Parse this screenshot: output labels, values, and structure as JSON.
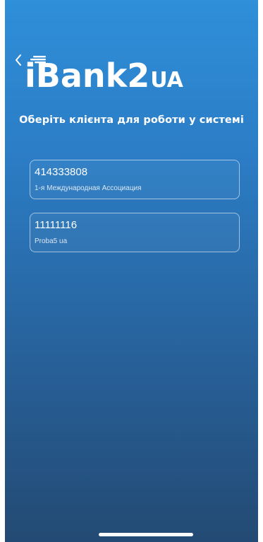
{
  "header": {
    "logo_main": "iBank2",
    "logo_suffix": "UA"
  },
  "heading": "Оберіть клієнта для роботи у системі",
  "clients": [
    {
      "id": "414333808",
      "name": "1-я Международная Ассоциация"
    },
    {
      "id": "11111116",
      "name": "Proba5 ua"
    }
  ],
  "colors": {
    "gradient_top": "#2f8fd9",
    "gradient_bottom": "#234a73",
    "text": "#ffffff"
  },
  "icons": {
    "back": "chevron-left-icon"
  }
}
